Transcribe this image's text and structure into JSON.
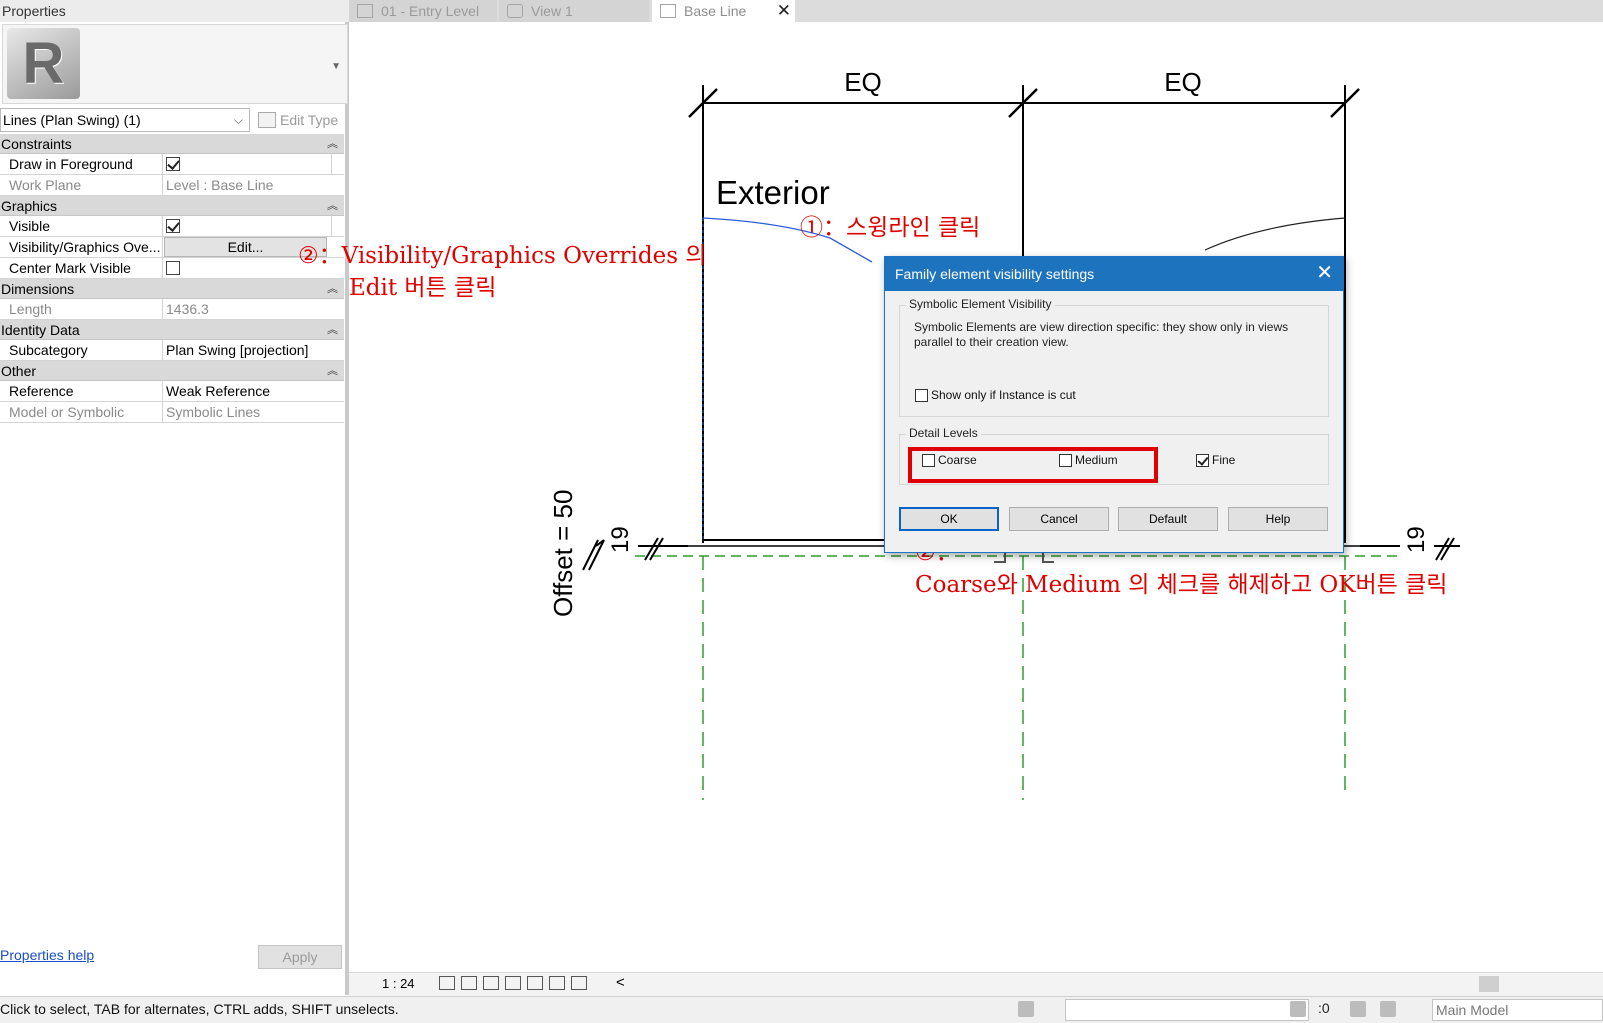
{
  "properties": {
    "header": "Properties",
    "logo_letter": "R",
    "type_selector": "Lines (Plan Swing) (1)",
    "edit_type": "Edit Type",
    "groups": {
      "constraints": "Constraints",
      "graphics": "Graphics",
      "dimensions": "Dimensions",
      "identity": "Identity Data",
      "other": "Other"
    },
    "rows": {
      "draw_fg": {
        "label": "Draw in Foreground",
        "checked": true
      },
      "work_plane": {
        "label": "Work Plane",
        "value": "Level : Base Line"
      },
      "visible": {
        "label": "Visible",
        "checked": true
      },
      "vg_overrides": {
        "label": "Visibility/Graphics Ove...",
        "button": "Edit..."
      },
      "center_mark": {
        "label": "Center Mark Visible",
        "checked": false
      },
      "length": {
        "label": "Length",
        "value": "1436.3"
      },
      "subcategory": {
        "label": "Subcategory",
        "value": "Plan Swing [projection]"
      },
      "reference": {
        "label": "Reference",
        "value": "Weak Reference"
      },
      "model_symbolic": {
        "label": "Model or Symbolic",
        "value": "Symbolic Lines"
      }
    },
    "help_link": "Properties help",
    "apply": "Apply"
  },
  "tabs": [
    {
      "label": "01 - Entry Level"
    },
    {
      "label": "View 1"
    },
    {
      "label": "Base Line",
      "close": "✕"
    }
  ],
  "drawing": {
    "dim_left": "EQ",
    "dim_right": "EQ",
    "room_label": "Exterior",
    "offset_label": "Offset = 50",
    "dim_small_left": "19",
    "dim_small_right": "19"
  },
  "annotations": {
    "a1": "①：스윙라인 클릭",
    "a2_line1": "②：Visibility/Graphics Overrides 의",
    "a2_line2": "Edit 버튼 클릭",
    "a3_line1": "②：",
    "a3_line2": "Coarse와 Medium 의 체크를 해제하고 OK버튼 클릭"
  },
  "dialog": {
    "title": "Family element visibility settings",
    "close": "✕",
    "symbolic_legend": "Symbolic Element Visibility",
    "symbolic_desc": "Symbolic Elements are view direction specific: they show only in views parallel to their creation view.",
    "show_if_cut": {
      "label": "Show only if Instance is cut",
      "checked": false
    },
    "detail_legend": "Detail Levels",
    "coarse": {
      "label": "Coarse",
      "checked": false
    },
    "medium": {
      "label": "Medium",
      "checked": false
    },
    "fine": {
      "label": "Fine",
      "checked": true
    },
    "buttons": {
      "ok": "OK",
      "cancel": "Cancel",
      "default": "Default",
      "help": "Help"
    }
  },
  "view_control": {
    "scale": "1 : 24",
    "arrow": "<"
  },
  "status": {
    "hint": "Click to select, TAB for alternates, CTRL adds, SHIFT unselects.",
    "filter": ":0",
    "model": "Main Model"
  },
  "colors": {
    "accent_blue": "#1e73be",
    "annotation_red": "#e00000",
    "ref_plane_green": "#2e9e2e",
    "swing_line_blue": "#2a5bd7"
  }
}
